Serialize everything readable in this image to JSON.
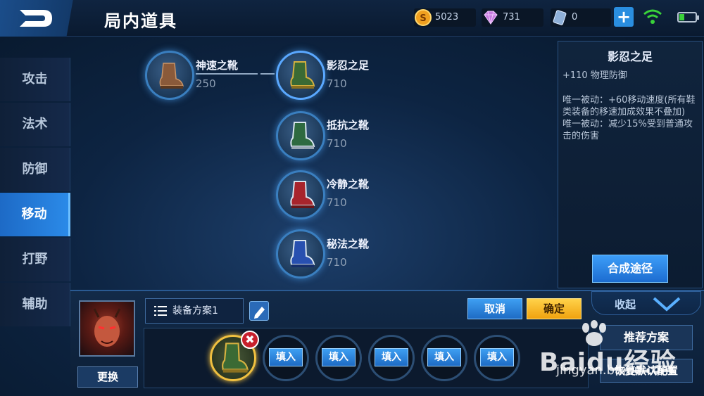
{
  "header": {
    "title": "局内道具"
  },
  "resources": {
    "gold": "5023",
    "diamond": "731",
    "voucher": "0"
  },
  "sidebar": {
    "items": [
      {
        "label": "攻击"
      },
      {
        "label": "法术"
      },
      {
        "label": "防御"
      },
      {
        "label": "移动",
        "active": true
      },
      {
        "label": "打野"
      },
      {
        "label": "辅助"
      }
    ]
  },
  "items": [
    {
      "name": "神速之靴",
      "price": "250",
      "icon": "boot-brown-icon"
    },
    {
      "name": "影忍之足",
      "price": "710",
      "icon": "boot-green-icon"
    },
    {
      "name": "抵抗之靴",
      "price": "710",
      "icon": "boot-green-silver-icon"
    },
    {
      "name": "冷静之靴",
      "price": "710",
      "icon": "boot-red-icon"
    },
    {
      "name": "秘法之靴",
      "price": "710",
      "icon": "boot-blue-icon"
    }
  ],
  "info": {
    "name": "影忍之足",
    "stat": "+110 物理防御",
    "passive1": "唯一被动：+60移动速度(所有鞋类装备的移速加成效果不叠加)",
    "passive2": "唯一被动：减少15%受到普通攻击的伤害",
    "compose_label": "合成途径"
  },
  "bottom": {
    "replace_label": "更换",
    "plan_label": "装备方案1",
    "cancel_label": "取消",
    "confirm_label": "确定",
    "collapse_label": "收起",
    "fill_label": "填入",
    "recommend_label": "推荐方案",
    "restore_label": "恢复默认配置"
  },
  "watermark": {
    "brand": "Baidu经验",
    "url": "jingyan.baidu.com"
  },
  "colors": {
    "accent": "#2b8ae8",
    "confirm": "#f0a20e",
    "remove": "#c8202c"
  }
}
